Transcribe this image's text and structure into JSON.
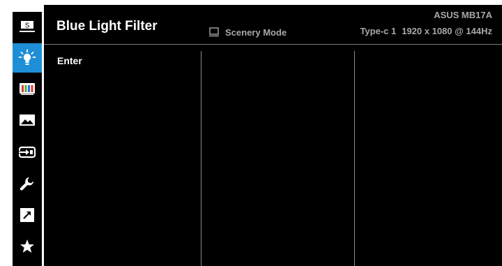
{
  "header": {
    "title": "Blue Light Filter",
    "model": "ASUS MB17A",
    "mode": "Scenery Mode",
    "input": "Type-c 1",
    "resolution": "1920 x 1080 @ 144Hz"
  },
  "menu": {
    "items": [
      "Enter"
    ]
  },
  "sidebar": {
    "items": [
      {
        "icon": "splendid-icon",
        "active": false
      },
      {
        "icon": "blue-light-bulb-icon",
        "active": true
      },
      {
        "icon": "color-bars-icon",
        "active": false
      },
      {
        "icon": "image-icon",
        "active": false
      },
      {
        "icon": "input-select-icon",
        "active": false
      },
      {
        "icon": "wrench-icon",
        "active": false
      },
      {
        "icon": "shortcut-arrow-icon",
        "active": false
      },
      {
        "icon": "star-icon",
        "active": false
      }
    ]
  },
  "colors": {
    "background": "#000000",
    "active_highlight": "#1e8fd6",
    "text_primary": "#ffffff",
    "text_secondary": "#a8a8a8"
  }
}
